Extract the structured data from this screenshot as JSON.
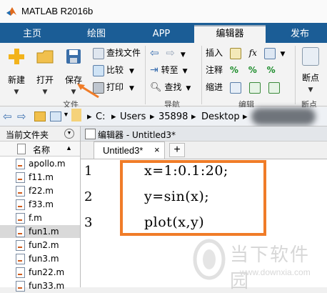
{
  "window": {
    "title": "MATLAB R2016b"
  },
  "tabs": [
    {
      "label": "主页"
    },
    {
      "label": "绘图"
    },
    {
      "label": "APP"
    },
    {
      "label": "编辑器"
    },
    {
      "label": "发布"
    }
  ],
  "ribbon": {
    "file_group": {
      "new_label": "新建",
      "open_label": "打开",
      "save_label": "保存",
      "find_files_label": "查找文件",
      "compare_label": "比较",
      "print_label": "打印",
      "group_label": "文件"
    },
    "nav_group": {
      "goto_label": "转至",
      "find_label": "查找",
      "group_label": "导航"
    },
    "edit_group": {
      "insert_label": "插入",
      "comment_label": "注释",
      "indent_label": "缩进",
      "fx_label": "fx",
      "percent_label": "%",
      "group_label": "编辑"
    },
    "breakpoints_group": {
      "breakpoints_label": "断点",
      "group_label": "断点"
    }
  },
  "address_bar": {
    "path": [
      "C:",
      "Users",
      "35898",
      "Desktop"
    ]
  },
  "current_folder": {
    "title": "当前文件夹",
    "column_header": "名称",
    "sort_indicator": "▲",
    "files": [
      "apollo.m",
      "f11.m",
      "f22.m",
      "f33.m",
      "f.m",
      "fun1.m",
      "fun2.m",
      "fun3.m",
      "fun22.m",
      "fun33.m"
    ],
    "selected_file": "fun1.m"
  },
  "editor": {
    "title": "编辑器 - Untitled3*",
    "tab_label": "Untitled3*",
    "close_glyph": "×",
    "add_glyph": "+",
    "lines": [
      {
        "num": "1",
        "code": "x=1:0.1:20;"
      },
      {
        "num": "2",
        "code": "y=sin(x);"
      },
      {
        "num": "3",
        "code": "plot(x,y)"
      }
    ]
  },
  "watermark": {
    "name": "当下软件园",
    "url": "www.downxia.com"
  },
  "colors": {
    "tab_bar": "#1b5d96",
    "highlight_box": "#f07c28",
    "annotation_arrow": "#f07c28"
  }
}
